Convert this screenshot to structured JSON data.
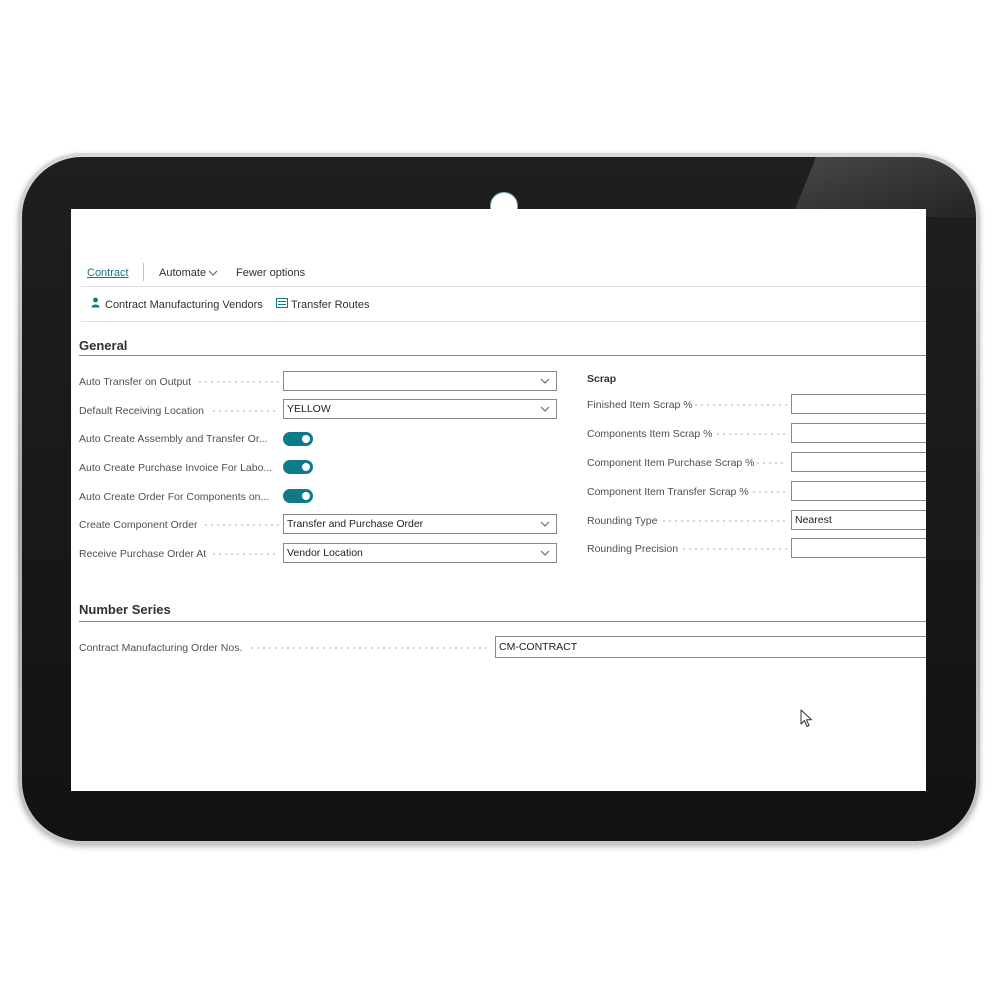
{
  "actionbar": {
    "tab_contract": "Contract",
    "tab_automate": "Automate",
    "tab_fewer": "Fewer options"
  },
  "toolbar": {
    "vendors_label": "Contract Manufacturing Vendors",
    "routes_label": "Transfer Routes"
  },
  "general": {
    "title": "General",
    "fields": {
      "auto_transfer_label": "Auto Transfer on Output",
      "auto_transfer_value": "",
      "default_location_label": "Default Receiving Location",
      "default_location_value": "YELLOW",
      "auto_assembly_label": "Auto Create Assembly and Transfer Or...",
      "auto_assembly_on": true,
      "auto_invoice_label": "Auto Create Purchase Invoice For Labo...",
      "auto_invoice_on": true,
      "auto_components_label": "Auto Create Order For Components on...",
      "auto_components_on": true,
      "create_component_label": "Create Component Order",
      "create_component_value": "Transfer and Purchase Order",
      "receive_po_label": "Receive Purchase Order At",
      "receive_po_value": "Vendor Location"
    }
  },
  "scrap": {
    "title": "Scrap",
    "finished_label": "Finished Item Scrap %",
    "finished_value": "",
    "components_label": "Components Item Scrap %",
    "components_value": "",
    "purchase_label": "Component Item Purchase Scrap %",
    "purchase_value": "",
    "transfer_label": "Component Item Transfer Scrap %",
    "transfer_value": "",
    "rounding_type_label": "Rounding Type",
    "rounding_type_value": "Nearest",
    "rounding_precision_label": "Rounding Precision",
    "rounding_precision_value": ""
  },
  "number_series": {
    "title": "Number Series",
    "cm_order_label": "Contract Manufacturing Order Nos.",
    "cm_order_value": "CM-CONTRACT"
  },
  "colors": {
    "accent": "#0f7b8a",
    "toggle_on": "#0f7b8a"
  },
  "icons": [
    "person-icon",
    "transfer-routes-icon",
    "chevron-down-icon",
    "mouse-cursor-icon"
  ]
}
